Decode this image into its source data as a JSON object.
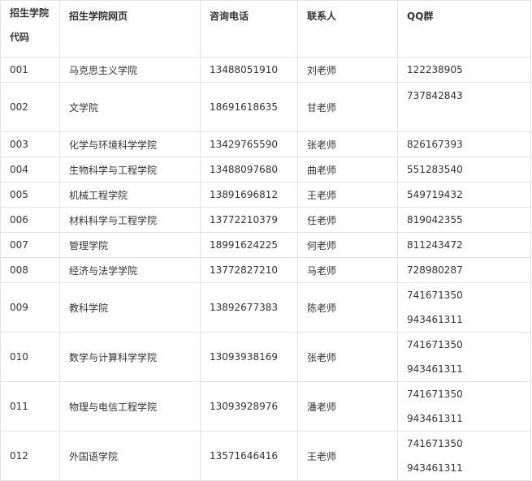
{
  "table": {
    "headers": {
      "code_line1": "招生学院",
      "code_line2": "代码",
      "website": "招生学院网页",
      "phone": "咨询电话",
      "contact": "联系人",
      "qq": "QQ群"
    },
    "rows": [
      {
        "code": "001",
        "college": "马克思主义学院",
        "phone": "13488051910",
        "contact": "刘老师",
        "qq": [
          "122238905"
        ]
      },
      {
        "code": "002",
        "college": "文学院",
        "phone": "18691618635",
        "contact": "甘老师",
        "qq": [
          "737842843"
        ]
      },
      {
        "code": "003",
        "college": "化学与环境科学学院",
        "phone": "13429765590",
        "contact": "张老师",
        "qq": [
          "826167393"
        ]
      },
      {
        "code": "004",
        "college": "生物科学与工程学院",
        "phone": "13488097680",
        "contact": "曲老师",
        "qq": [
          "551283540"
        ]
      },
      {
        "code": "005",
        "college": "机械工程学院",
        "phone": "13891696812",
        "contact": "王老师",
        "qq": [
          "549719432"
        ]
      },
      {
        "code": "006",
        "college": "材料科学与工程学院",
        "phone": "13772210379",
        "contact": "任老师",
        "qq": [
          "819042355"
        ]
      },
      {
        "code": "007",
        "college": "管理学院",
        "phone": "18991624225",
        "contact": "何老师",
        "qq": [
          "811243472"
        ]
      },
      {
        "code": "008",
        "college": "经济与法学学院",
        "phone": "13772827210",
        "contact": "马老师",
        "qq": [
          "728980287"
        ]
      },
      {
        "code": "009",
        "college": "教科学院",
        "phone": "13892677383",
        "contact": "陈老师",
        "qq": [
          "741671350",
          "943461311"
        ]
      },
      {
        "code": "010",
        "college": "数学与计算科学学院",
        "phone": "13093938169",
        "contact": "张老师",
        "qq": [
          "741671350",
          "943461311"
        ]
      },
      {
        "code": "011",
        "college": "物理与电信工程学院",
        "phone": "13093928976",
        "contact": "潘老师",
        "qq": [
          "741671350",
          "943461311"
        ]
      },
      {
        "code": "012",
        "college": "外国语学院",
        "phone": "13571646416",
        "contact": "王老师",
        "qq": [
          "741671350",
          "943461311"
        ]
      }
    ]
  }
}
